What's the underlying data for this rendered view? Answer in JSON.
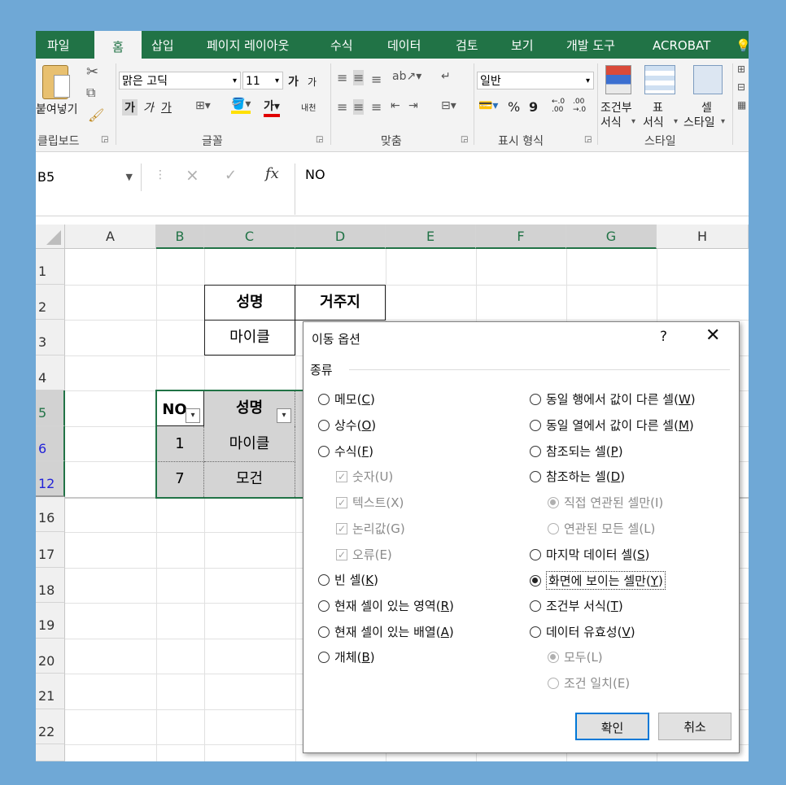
{
  "tabs": [
    "파일",
    "홈",
    "삽입",
    "페이지 레이아웃",
    "수식",
    "데이터",
    "검토",
    "보기",
    "개발 도구",
    "ACROBAT"
  ],
  "active_tab": "홈",
  "ribbon": {
    "paste_label": "붙여넣기",
    "font_name": "맑은 고딕",
    "font_size": "11",
    "number_format": "일반",
    "bold_label": "가",
    "italic_label": "가",
    "underline_label": "가",
    "grow_font": "가",
    "shrink_font": "가",
    "phonetic": "내천",
    "percent": "%",
    "comma": "9",
    "inc_decimal": "←.0\n.00",
    "dec_decimal": ".00\n→.0",
    "cond_format_1": "조건부",
    "cond_format_2": "서식",
    "table_format_1": "표",
    "table_format_2": "서식",
    "cell_style_1": "셀",
    "cell_style_2": "스타일",
    "groups": {
      "clipboard": "클립보드",
      "font": "글꼴",
      "alignment": "맞춤",
      "number": "표시 형식",
      "styles": "스타일"
    }
  },
  "formula_bar": {
    "name_box": "B5",
    "cancel": "×",
    "enter": "✓",
    "fx": "fx",
    "content": "NO"
  },
  "columns": [
    "A",
    "B",
    "C",
    "D",
    "E",
    "F",
    "G",
    "H"
  ],
  "rows": [
    "1",
    "2",
    "3",
    "4",
    "5",
    "6",
    "12",
    "16",
    "17",
    "18",
    "19",
    "20",
    "21",
    "22"
  ],
  "table1": {
    "header_name": "성명",
    "header_addr": "거주지",
    "row_name": "마이클"
  },
  "table2": {
    "header_no": "NO",
    "header_name": "성명",
    "rows": [
      {
        "no": "1",
        "name": "마이클"
      },
      {
        "no": "7",
        "name": "모건"
      }
    ]
  },
  "dialog": {
    "title": "이동 옵션",
    "help": "?",
    "close": "✕",
    "group": "종류",
    "left": [
      {
        "label": "메모",
        "key": "C"
      },
      {
        "label": "상수",
        "key": "O"
      },
      {
        "label": "수식",
        "key": "F"
      },
      {
        "label": "숫자(U)"
      },
      {
        "label": "텍스트(X)"
      },
      {
        "label": "논리값(G)"
      },
      {
        "label": "오류(E)"
      },
      {
        "label": "빈 셀",
        "key": "K"
      },
      {
        "label": "현재 셀이 있는 영역",
        "key": "R"
      },
      {
        "label": "현재 셀이 있는 배열",
        "key": "A"
      },
      {
        "label": "개체",
        "key": "B"
      }
    ],
    "right": [
      {
        "label": "동일 행에서 값이 다른 셀",
        "key": "W"
      },
      {
        "label": "동일 열에서 값이 다른 셀",
        "key": "M"
      },
      {
        "label": "참조되는 셀",
        "key": "P"
      },
      {
        "label": "참조하는 셀",
        "key": "D"
      },
      {
        "label": "직접 연관된 셀만(I)"
      },
      {
        "label": "연관된 모든 셀(L)"
      },
      {
        "label": "마지막 데이터 셀",
        "key": "S"
      },
      {
        "label": "화면에 보이는 셀만",
        "key": "Y"
      },
      {
        "label": "조건부 서식",
        "key": "T"
      },
      {
        "label": "데이터 유효성",
        "key": "V"
      },
      {
        "label": "모두(L)"
      },
      {
        "label": "조건 일치(E)"
      }
    ],
    "selected": "화면에 보이는 셀만",
    "ok": "확인",
    "cancel": "취소"
  },
  "colors": {
    "excel_green": "#217346",
    "background": "#6fa8d6"
  }
}
